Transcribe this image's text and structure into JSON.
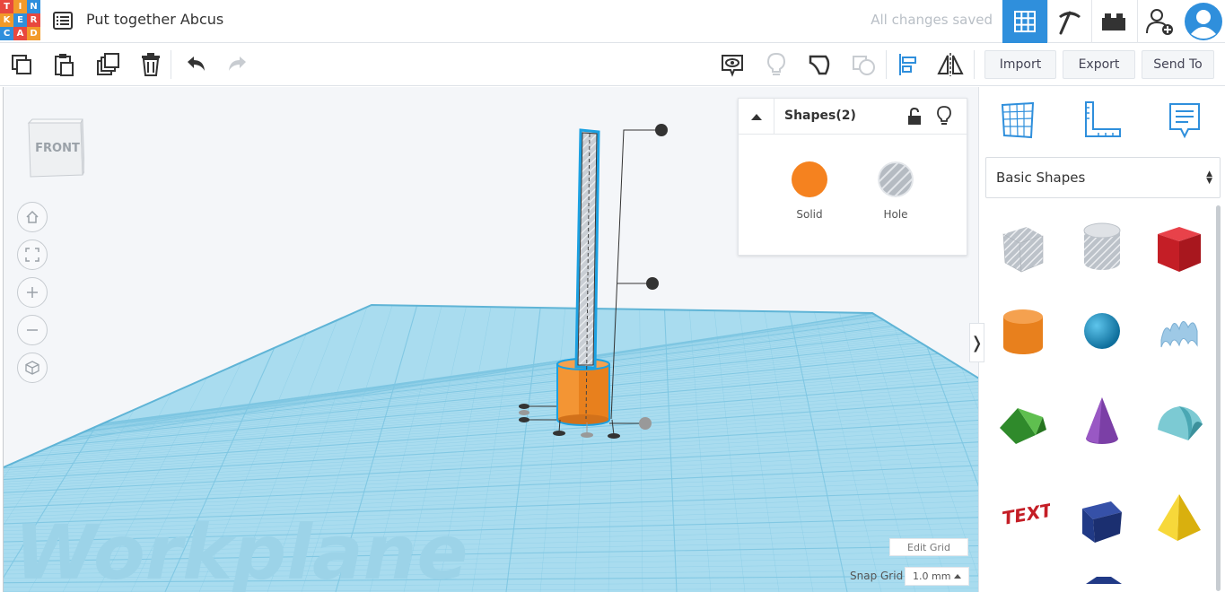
{
  "header": {
    "logo_letters": [
      "T",
      "I",
      "N",
      "K",
      "E",
      "R",
      "C",
      "A",
      "D"
    ],
    "logo_colors": [
      "#e8483e",
      "#f29a2a",
      "#2f8fdc",
      "#f29a2a",
      "#2f8fdc",
      "#e8483e",
      "#2f8fdc",
      "#e8483e",
      "#f29a2a"
    ],
    "title": "Put together Abcus",
    "status": "All changes saved",
    "accent": "#2f8fdc",
    "buttons": [
      "grid-view-icon",
      "pickaxe-icon",
      "brick-icon",
      "add-user-icon",
      "avatar-icon"
    ]
  },
  "toolbar": {
    "left_tools": [
      "copy-icon",
      "paste-icon",
      "duplicate-icon",
      "trash-icon",
      "undo-icon",
      "redo-icon"
    ],
    "right_tools": [
      "notes-icon",
      "lightbulb-icon",
      "group-icon",
      "ungroup-icon",
      "align-icon",
      "mirror-icon"
    ],
    "import_label": "Import",
    "export_label": "Export",
    "send_to_label": "Send To"
  },
  "viewport": {
    "viewcube_label": "FRONT",
    "workplane_text": "Workplane",
    "edit_grid_label": "Edit Grid",
    "snap_grid_label": "Snap Grid",
    "snap_grid_value": "1.0 mm",
    "nav_buttons": [
      "home-icon",
      "fit-view-icon",
      "zoom-in-icon",
      "zoom-out-icon",
      "perspective-icon"
    ],
    "workplane_color": "#a9dcef",
    "grid_line_color": "#7ec6e2",
    "solid_color": "#f5821f",
    "selection_color": "#1ba1e2"
  },
  "inspector": {
    "title": "Shapes(2)",
    "solid_label": "Solid",
    "hole_label": "Hole",
    "solid_color": "#f5821f"
  },
  "shapes_panel": {
    "tabs": [
      "workplane-icon",
      "ruler-icon",
      "notes-icon"
    ],
    "category": "Basic Shapes",
    "shapes": [
      {
        "name": "box-hole",
        "color": "#c9ced4"
      },
      {
        "name": "cylinder-hole",
        "color": "#c9ced4"
      },
      {
        "name": "box",
        "color": "#d8242c"
      },
      {
        "name": "cylinder",
        "color": "#f5821f"
      },
      {
        "name": "sphere",
        "color": "#1f97c9"
      },
      {
        "name": "scribble",
        "color": "#8fbfe0"
      },
      {
        "name": "roof",
        "color": "#3f9d3a"
      },
      {
        "name": "cone",
        "color": "#7b3fa6"
      },
      {
        "name": "round-roof",
        "color": "#5fb9c6"
      },
      {
        "name": "text",
        "color": "#d8242c"
      },
      {
        "name": "wedge",
        "color": "#1f3f8f"
      },
      {
        "name": "pyramid",
        "color": "#f2cd1b"
      }
    ]
  }
}
